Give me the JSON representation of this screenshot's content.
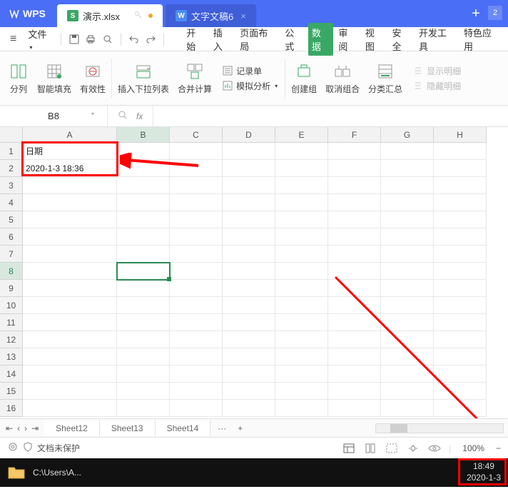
{
  "title": {
    "app": "WPS",
    "active_tab": "演示.xlsx",
    "inactive_tab": "文字文稿6"
  },
  "menu": {
    "file": "文件",
    "tabs": [
      "开始",
      "插入",
      "页面布局",
      "公式",
      "数据",
      "审阅",
      "视图",
      "安全",
      "开发工具",
      "特色应用"
    ],
    "active_index": 4
  },
  "ribbon": {
    "split": "分列",
    "smartfill": "智能填充",
    "validity": "有效性",
    "dropdown": "插入下拉列表",
    "consolidate": "合并计算",
    "record": "记录单",
    "simanalysis": "模拟分析",
    "group": "创建组",
    "ungroup": "取消组合",
    "subtotal": "分类汇总",
    "show_detail": "显示明细",
    "hide_detail": "隐藏明细"
  },
  "namebox": "B8",
  "columns": [
    "A",
    "B",
    "C",
    "D",
    "E",
    "F",
    "G",
    "H"
  ],
  "rows": [
    "1",
    "2",
    "3",
    "4",
    "5",
    "6",
    "7",
    "8",
    "9",
    "10",
    "11",
    "12",
    "13",
    "14",
    "15",
    "16"
  ],
  "cells": {
    "A1": "日期",
    "A2": "2020-1-3 18:36"
  },
  "active_cell": "B8",
  "sheets": [
    "Sheet12",
    "Sheet13",
    "Sheet14"
  ],
  "status": {
    "protect": "文档未保护",
    "zoom": "100%"
  },
  "taskbar": {
    "path": "C:\\Users\\A...",
    "time": "18:49",
    "date": "2020-1-3"
  }
}
